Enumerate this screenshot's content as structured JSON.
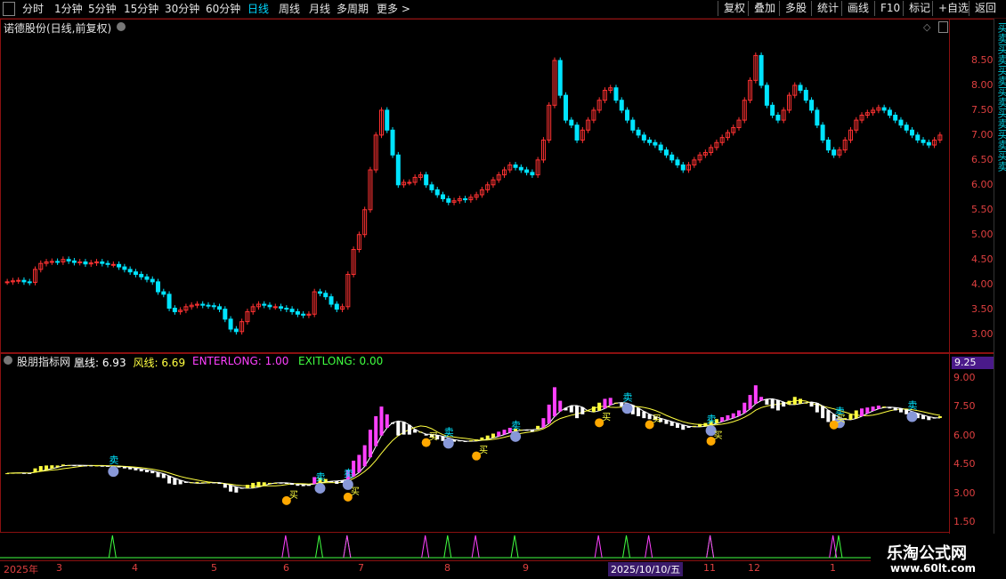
{
  "toolbar": {
    "items": [
      "分时",
      "1分钟",
      "5分钟",
      "15分钟",
      "30分钟",
      "60分钟",
      "日线",
      "周线",
      "月线",
      "多周期",
      "更多 >"
    ],
    "active": "日线",
    "right_items": [
      "复权",
      "叠加",
      "多股",
      "统计",
      "画线",
      "F10",
      "标记",
      "+自选",
      "返回"
    ]
  },
  "main_panel": {
    "title": "诺德股份(日线,前复权)",
    "y_ticks": [
      "8.50",
      "8.00",
      "7.50",
      "7.00",
      "6.50",
      "6.00",
      "5.50",
      "5.00",
      "4.50",
      "4.00",
      "3.50",
      "3.00"
    ]
  },
  "indicator_panel": {
    "title": "股朋指标网",
    "legend": [
      {
        "label": "凰线:",
        "value": "6.93",
        "color": "#ffffff"
      },
      {
        "label": "风线:",
        "value": "6.69",
        "color": "#ffff40"
      },
      {
        "label": "ENTERLONG:",
        "value": "1.00",
        "color": "#ff40ff"
      },
      {
        "label": "EXITLONG:",
        "value": "0.00",
        "color": "#40ff40"
      }
    ],
    "current_value": "9.25",
    "y_ticks": [
      "9.00",
      "7.50",
      "6.00",
      "4.50",
      "3.00",
      "1.50"
    ],
    "buy_label": "买",
    "sell_label": "卖"
  },
  "date_axis": {
    "labels": [
      "2025年",
      "3",
      "4",
      "5",
      "6",
      "7",
      "8",
      "9",
      "2025/10/10/五",
      "11",
      "12",
      "1"
    ]
  },
  "right_strip": {
    "text": "买卖买卖买卖买卖买卖买卖买卖"
  },
  "watermark": {
    "line1": "乐淘公式网",
    "line2": "www.60lt.com"
  },
  "colors": {
    "up": "#ff3232",
    "down": "#00e4ff",
    "axis": "#e04040",
    "border": "#8a1010",
    "line1": "#ffffff",
    "line2": "#ffff40",
    "enter": "#ff40ff",
    "exit": "#40ff40"
  },
  "chart_data": {
    "type": "candlestick",
    "title": "诺德股份(日线,前复权)",
    "price_range": [
      2.85,
      9.0
    ],
    "closes": [
      4.05,
      4.07,
      4.08,
      4.05,
      4.04,
      4.3,
      4.42,
      4.45,
      4.46,
      4.45,
      4.5,
      4.47,
      4.44,
      4.45,
      4.41,
      4.43,
      4.45,
      4.42,
      4.4,
      4.4,
      4.35,
      4.3,
      4.25,
      4.2,
      4.15,
      4.1,
      4.05,
      3.85,
      3.8,
      3.52,
      3.45,
      3.48,
      3.55,
      3.58,
      3.6,
      3.58,
      3.57,
      3.55,
      3.5,
      3.3,
      3.1,
      3.05,
      3.25,
      3.45,
      3.55,
      3.6,
      3.58,
      3.55,
      3.55,
      3.52,
      3.5,
      3.45,
      3.4,
      3.38,
      3.4,
      3.85,
      3.82,
      3.75,
      3.6,
      3.5,
      3.55,
      4.2,
      4.7,
      5.0,
      5.5,
      6.3,
      7.0,
      7.5,
      7.1,
      6.6,
      6.0,
      6.05,
      6.05,
      6.15,
      6.2,
      6.0,
      5.9,
      5.8,
      5.72,
      5.65,
      5.68,
      5.72,
      5.7,
      5.75,
      5.8,
      5.9,
      6.0,
      6.1,
      6.2,
      6.3,
      6.4,
      6.35,
      6.3,
      6.25,
      6.2,
      6.5,
      6.9,
      7.6,
      8.5,
      7.8,
      7.3,
      7.2,
      6.9,
      7.1,
      7.3,
      7.5,
      7.7,
      7.9,
      7.95,
      7.7,
      7.5,
      7.3,
      7.1,
      7.0,
      6.9,
      6.85,
      6.8,
      6.7,
      6.6,
      6.5,
      6.4,
      6.3,
      6.4,
      6.5,
      6.6,
      6.65,
      6.75,
      6.85,
      6.95,
      7.05,
      7.15,
      7.3,
      7.7,
      8.1,
      8.6,
      8.0,
      7.6,
      7.4,
      7.3,
      7.5,
      7.8,
      8.0,
      7.9,
      7.7,
      7.5,
      7.2,
      6.9,
      6.7,
      6.6,
      6.7,
      6.9,
      7.1,
      7.3,
      7.4,
      7.45,
      7.5,
      7.55,
      7.5,
      7.4,
      7.3,
      7.2,
      7.1,
      7.0,
      6.9,
      6.85,
      6.8,
      6.9,
      7.0
    ]
  }
}
